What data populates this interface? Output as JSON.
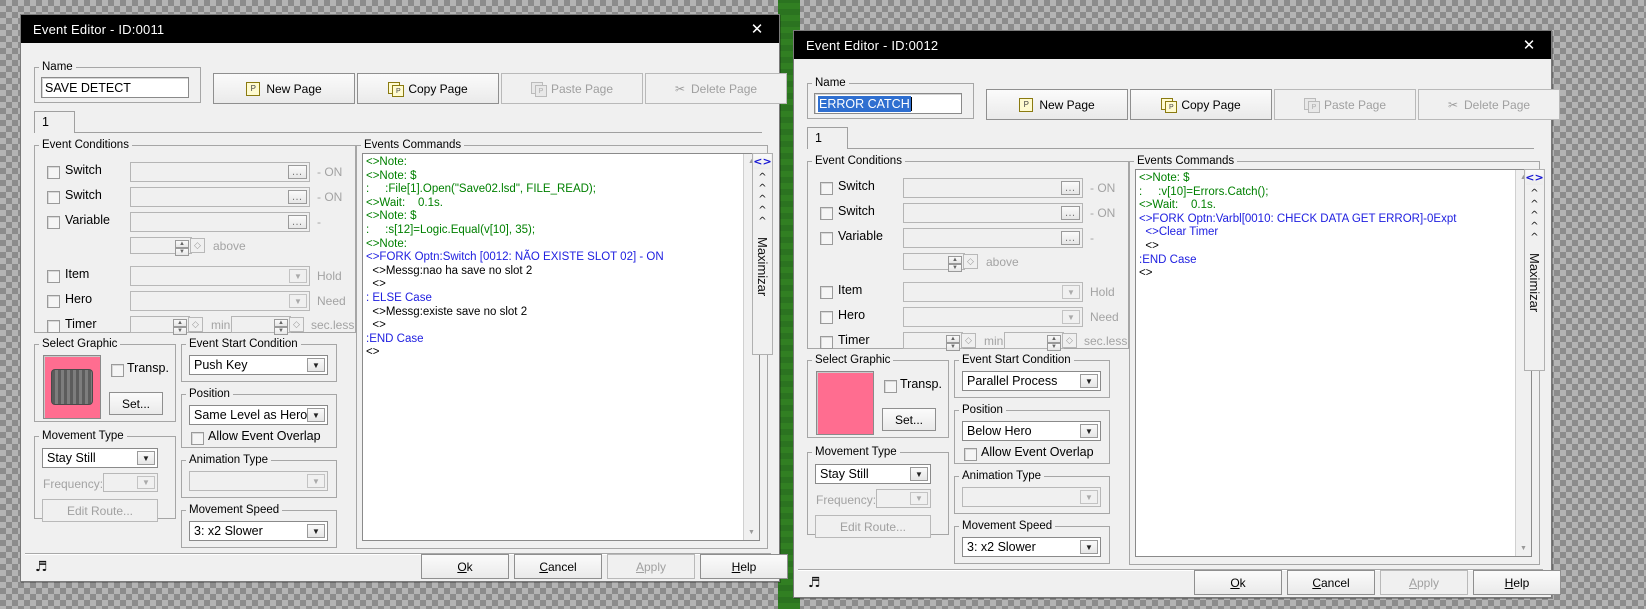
{
  "desktop": {
    "map_strip_color": "#2f7f1e"
  },
  "windows": [
    {
      "id": "window-1",
      "title": "Event Editor - ID:0011",
      "close_label": "✕",
      "name_group": "Name",
      "name_value": "SAVE DETECT",
      "name_selected": false,
      "page_buttons": [
        {
          "label": "New Page",
          "icon": "new-page-icon",
          "disabled": false
        },
        {
          "label": "Copy Page",
          "icon": "copy-page-icon",
          "disabled": false
        },
        {
          "label": "Paste Page",
          "icon": "paste-page-icon",
          "disabled": true
        },
        {
          "label": "Delete Page",
          "icon": "delete-page-icon",
          "disabled": true
        }
      ],
      "tab_label": "1",
      "conditions_group": "Event Conditions",
      "conditions": [
        {
          "label": "Switch",
          "checked": false,
          "value": "",
          "suffix": "- ON",
          "widget": "dots"
        },
        {
          "label": "Switch",
          "checked": false,
          "value": "",
          "suffix": "- ON",
          "widget": "dots"
        },
        {
          "label": "Variable",
          "checked": false,
          "value": "",
          "suffix": "-",
          "widget": "dots"
        },
        {
          "label": "",
          "checked": null,
          "value": "",
          "suffix": "above",
          "widget": "spin"
        },
        {
          "label": "Item",
          "checked": false,
          "value": "",
          "suffix": "Hold",
          "widget": "combo"
        },
        {
          "label": "Hero",
          "checked": false,
          "value": "",
          "suffix": "Need",
          "widget": "combo"
        },
        {
          "label": "Timer",
          "checked": false,
          "value": "",
          "suffix": "sec.less",
          "widget": "timer",
          "mid_suffix": "min"
        }
      ],
      "select_graphic_group": "Select Graphic",
      "transp_label": "Transp.",
      "transp_checked": false,
      "set_label": "Set...",
      "graphic_bg": "#ff6d90",
      "graphic_has_sprite": true,
      "movement_type_group": "Movement Type",
      "movement_type_value": "Stay Still",
      "frequency_label": "Frequency:",
      "frequency_value": "",
      "edit_route_label": "Edit Route...",
      "event_start_group": "Event Start Condition",
      "event_start_value": "Push Key",
      "position_group": "Position",
      "position_value": "Same Level as Hero",
      "allow_overlap_label": "Allow Event Overlap",
      "allow_overlap_checked": false,
      "animation_type_group": "Animation Type",
      "animation_type_value": "",
      "movement_speed_group": "Movement Speed",
      "movement_speed_value": "3: x2 Slower",
      "commands_group": "Events Commands",
      "maximize_label": "Maximizar",
      "maximize_icon": "<>",
      "maximize_chevrons": "^^^^^",
      "commands": [
        {
          "indent": 0,
          "color": "green",
          "text": "<>Note:"
        },
        {
          "indent": 0,
          "color": "green",
          "text": "<>Note: $"
        },
        {
          "indent": 0,
          "color": "green",
          "text": ":     :File[1].Open(\"Save02.lsd\", FILE_READ);"
        },
        {
          "indent": 0,
          "color": "green",
          "text": "<>Wait:    0.1s."
        },
        {
          "indent": 0,
          "color": "green",
          "text": "<>Note: $"
        },
        {
          "indent": 0,
          "color": "green",
          "text": ":     :s[12]=Logic.Equal(v[10], 35);"
        },
        {
          "indent": 0,
          "color": "green",
          "text": "<>Note:"
        },
        {
          "indent": 0,
          "color": "blue",
          "text": "<>FORK Optn:Switch [0012: NÃO EXISTE SLOT 02] - ON"
        },
        {
          "indent": 1,
          "color": "black",
          "text": "<>Messg:nao ha save no slot 2"
        },
        {
          "indent": 1,
          "color": "black",
          "text": "<>"
        },
        {
          "indent": 0,
          "color": "blue",
          "text": ": ELSE Case"
        },
        {
          "indent": 1,
          "color": "black",
          "text": "<>Messg:existe save no slot 2"
        },
        {
          "indent": 1,
          "color": "black",
          "text": "<>"
        },
        {
          "indent": 0,
          "color": "blue",
          "text": ":END Case"
        },
        {
          "indent": 0,
          "color": "black",
          "text": "<>"
        }
      ],
      "footer": {
        "music_icon": "music-note-icon",
        "buttons": [
          {
            "label": "Ok",
            "accel": "O",
            "disabled": false
          },
          {
            "label": "Cancel",
            "accel": "C",
            "disabled": false
          },
          {
            "label": "Apply",
            "accel": "A",
            "disabled": true
          },
          {
            "label": "Help",
            "accel": "H",
            "disabled": false
          }
        ]
      }
    },
    {
      "id": "window-2",
      "title": "Event Editor - ID:0012",
      "close_label": "✕",
      "name_group": "Name",
      "name_value": "ERROR CATCH",
      "name_selected": true,
      "page_buttons": [
        {
          "label": "New Page",
          "icon": "new-page-icon",
          "disabled": false
        },
        {
          "label": "Copy Page",
          "icon": "copy-page-icon",
          "disabled": false
        },
        {
          "label": "Paste Page",
          "icon": "paste-page-icon",
          "disabled": true
        },
        {
          "label": "Delete Page",
          "icon": "delete-page-icon",
          "disabled": true
        }
      ],
      "tab_label": "1",
      "conditions_group": "Event Conditions",
      "conditions": [
        {
          "label": "Switch",
          "checked": false,
          "value": "",
          "suffix": "- ON",
          "widget": "dots"
        },
        {
          "label": "Switch",
          "checked": false,
          "value": "",
          "suffix": "- ON",
          "widget": "dots"
        },
        {
          "label": "Variable",
          "checked": false,
          "value": "",
          "suffix": "-",
          "widget": "dots"
        },
        {
          "label": "",
          "checked": null,
          "value": "",
          "suffix": "above",
          "widget": "spin"
        },
        {
          "label": "Item",
          "checked": false,
          "value": "",
          "suffix": "Hold",
          "widget": "combo"
        },
        {
          "label": "Hero",
          "checked": false,
          "value": "",
          "suffix": "Need",
          "widget": "combo"
        },
        {
          "label": "Timer",
          "checked": false,
          "value": "",
          "suffix": "sec.less",
          "widget": "timer",
          "mid_suffix": "min"
        }
      ],
      "select_graphic_group": "Select Graphic",
      "transp_label": "Transp.",
      "transp_checked": false,
      "set_label": "Set...",
      "graphic_bg": "#ff6d90",
      "graphic_has_sprite": false,
      "movement_type_group": "Movement Type",
      "movement_type_value": "Stay Still",
      "frequency_label": "Frequency:",
      "frequency_value": "",
      "edit_route_label": "Edit Route...",
      "event_start_group": "Event Start Condition",
      "event_start_value": "Parallel Process",
      "position_group": "Position",
      "position_value": "Below Hero",
      "allow_overlap_label": "Allow Event Overlap",
      "allow_overlap_checked": false,
      "animation_type_group": "Animation Type",
      "animation_type_value": "",
      "movement_speed_group": "Movement Speed",
      "movement_speed_value": "3: x2 Slower",
      "commands_group": "Events Commands",
      "maximize_label": "Maximizar",
      "maximize_icon": "<>",
      "maximize_chevrons": "^^^^^",
      "commands": [
        {
          "indent": 0,
          "color": "green",
          "text": "<>Note: $"
        },
        {
          "indent": 0,
          "color": "green",
          "text": ":     :v[10]=Errors.Catch();"
        },
        {
          "indent": 0,
          "color": "green",
          "text": "<>Wait:    0.1s."
        },
        {
          "indent": 0,
          "color": "blue",
          "text": "<>FORK Optn:Varbl[0010: CHECK DATA GET ERROR]-0Expt"
        },
        {
          "indent": 1,
          "color": "blue",
          "text": "<>Clear Timer"
        },
        {
          "indent": 1,
          "color": "black",
          "text": "<>"
        },
        {
          "indent": 0,
          "color": "blue",
          "text": ":END Case"
        },
        {
          "indent": 0,
          "color": "black",
          "text": "<>"
        }
      ],
      "footer": {
        "music_icon": "music-note-icon",
        "buttons": [
          {
            "label": "Ok",
            "accel": "O",
            "disabled": false
          },
          {
            "label": "Cancel",
            "accel": "C",
            "disabled": false
          },
          {
            "label": "Apply",
            "accel": "A",
            "disabled": true
          },
          {
            "label": "Help",
            "accel": "H",
            "disabled": false
          }
        ]
      }
    }
  ]
}
